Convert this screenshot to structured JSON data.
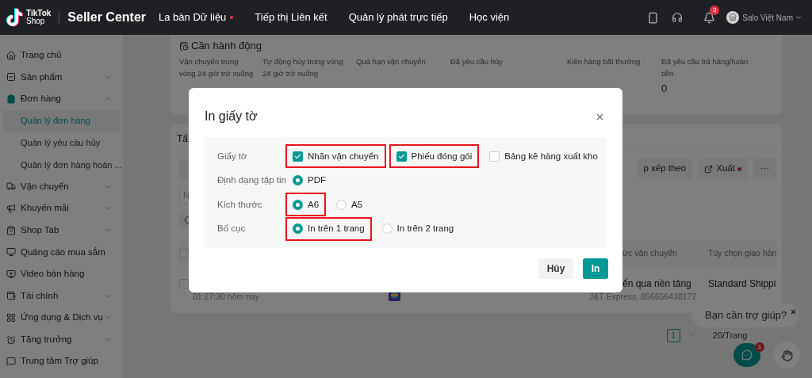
{
  "topbar": {
    "logo": {
      "line1": "TikTok",
      "line2": "Shop"
    },
    "app_name": "Seller Center",
    "nav": [
      {
        "label": "La bàn Dữ liệu",
        "dot": true
      },
      {
        "label": "Tiếp thị Liên kết",
        "dot": false
      },
      {
        "label": "Quản lý phát trực tiếp",
        "dot": false
      },
      {
        "label": "Học viện",
        "dot": false
      }
    ],
    "notification_count": "3",
    "account": "Salo Việt Nam"
  },
  "sidebar": {
    "items": [
      {
        "label": "Trang chủ",
        "selected": false
      },
      {
        "label": "Sản phẩm",
        "selected": false,
        "expanded": false
      },
      {
        "label": "Đơn hàng",
        "selected": true,
        "expanded": true,
        "children": [
          {
            "label": "Quản lý đơn hàng",
            "selected": true
          },
          {
            "label": "Quản lý yêu cầu hủy",
            "selected": false
          },
          {
            "label": "Quản lý đơn hàng hoàn ...",
            "selected": false
          }
        ]
      },
      {
        "label": "Vận chuyển",
        "selected": false,
        "expanded": false
      },
      {
        "label": "Khuyến mãi",
        "selected": false,
        "expanded": false
      },
      {
        "label": "Shop Tab",
        "selected": false,
        "expanded": false
      },
      {
        "label": "Quảng cáo mua sắm",
        "selected": false
      },
      {
        "label": "Video bán hàng",
        "selected": false
      },
      {
        "label": "Tài chính",
        "selected": false,
        "expanded": false
      },
      {
        "label": "Ứng dụng & Dịch vụ",
        "selected": false,
        "expanded": false
      },
      {
        "label": "Tăng trưởng",
        "selected": false,
        "expanded": false
      },
      {
        "label": "Trung tâm Trợ giúp",
        "selected": false
      }
    ]
  },
  "action_card": {
    "title": "Cần hành động",
    "stats": [
      {
        "label": "Vận chuyển trong vòng 24 giờ trở xuống"
      },
      {
        "label": "Tự động hủy trong vòng 24 giờ trở xuống"
      },
      {
        "label": "Quá hạn vận chuyển"
      },
      {
        "label": "Đã yêu cầu hủy"
      },
      {
        "label": "Kiện hàng bất thường"
      },
      {
        "label": "Đã yêu cầu trả hàng/hoàn tiền",
        "value": "0"
      }
    ]
  },
  "orders_card": {
    "title": "Tấ",
    "filter_placeholder": "N",
    "toolbar": [
      {
        "label": "p xếp theo",
        "kind": "plain"
      },
      {
        "label": "Xuất",
        "kind": "export",
        "dot": true
      },
      {
        "label": "···",
        "kind": "more"
      }
    ],
    "table": {
      "header_checked": false,
      "columns": [
        "ức vận chuyển",
        "Tùy chọn giao hàn"
      ],
      "rows": [
        {
          "checked": false,
          "cells": [
            "ển qua nền tảng",
            "Standard Shippi"
          ],
          "time": "01:27:30 hôm nay",
          "tracking": "J&T Express, 856656438172"
        }
      ]
    }
  },
  "pagination": {
    "pages": [
      {
        "label": "1",
        "selected": true
      }
    ],
    "page_size": "20/Trang"
  },
  "help_widget": {
    "message": "Bạn cần trợ giúp?",
    "chat_badge": "1"
  },
  "dialog": {
    "title": "In giấy tờ",
    "rows": [
      {
        "label": "Giấy tờ",
        "kind": "checkbox",
        "options": [
          {
            "label": "Nhãn vận chuyển",
            "checked": true,
            "highlighted": true
          },
          {
            "label": "Phiếu đóng gói",
            "checked": true,
            "highlighted": true
          },
          {
            "label": "Bảng kê hàng xuất kho",
            "checked": false,
            "highlighted": false
          }
        ]
      },
      {
        "label": "Định dạng tập tin",
        "kind": "radio",
        "options": [
          {
            "label": "PDF",
            "selected": true,
            "highlighted": false
          }
        ]
      },
      {
        "label": "Kích thước",
        "kind": "radio",
        "options": [
          {
            "label": "A6",
            "selected": true,
            "highlighted": true
          },
          {
            "label": "A5",
            "selected": false,
            "highlighted": false
          }
        ]
      },
      {
        "label": "Bố cục",
        "kind": "radio",
        "options": [
          {
            "label": "In trên 1 trang",
            "selected": true,
            "highlighted": true
          },
          {
            "label": "In trên 2 trang",
            "selected": false,
            "highlighted": false
          }
        ]
      }
    ],
    "buttons": [
      {
        "label": "Hủy",
        "kind": "secondary"
      },
      {
        "label": "In",
        "kind": "primary"
      }
    ]
  }
}
